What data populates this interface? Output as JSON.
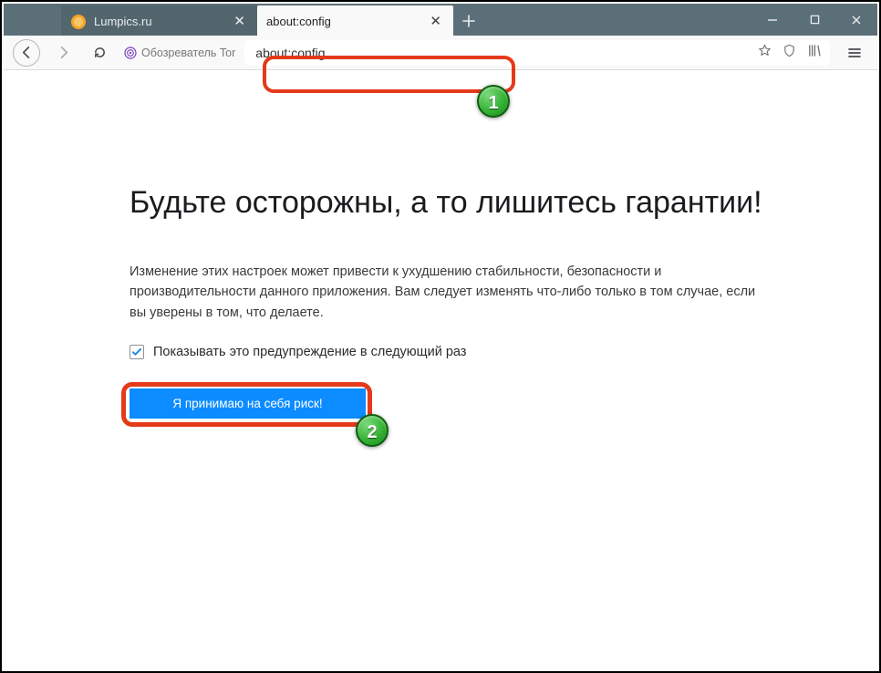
{
  "tabs": {
    "inactive_title": "Lumpics.ru",
    "active_title": "about:config"
  },
  "nav": {
    "tor_label": "Обозреватель Tor",
    "url_value": "about:config"
  },
  "page": {
    "heading": "Будьте осторожны, а то лишитесь гарантии!",
    "body": "Изменение этих настроек может привести к ухудшению стабильности, безопасности и производительности данного приложения. Вам следует изменять что-либо только в том случае, если вы уверены в том, что делаете.",
    "checkbox_label": "Показывать это предупреждение в следующий раз",
    "button_label": "Я принимаю на себя риск!"
  },
  "annotations": {
    "badge1": "1",
    "badge2": "2"
  }
}
